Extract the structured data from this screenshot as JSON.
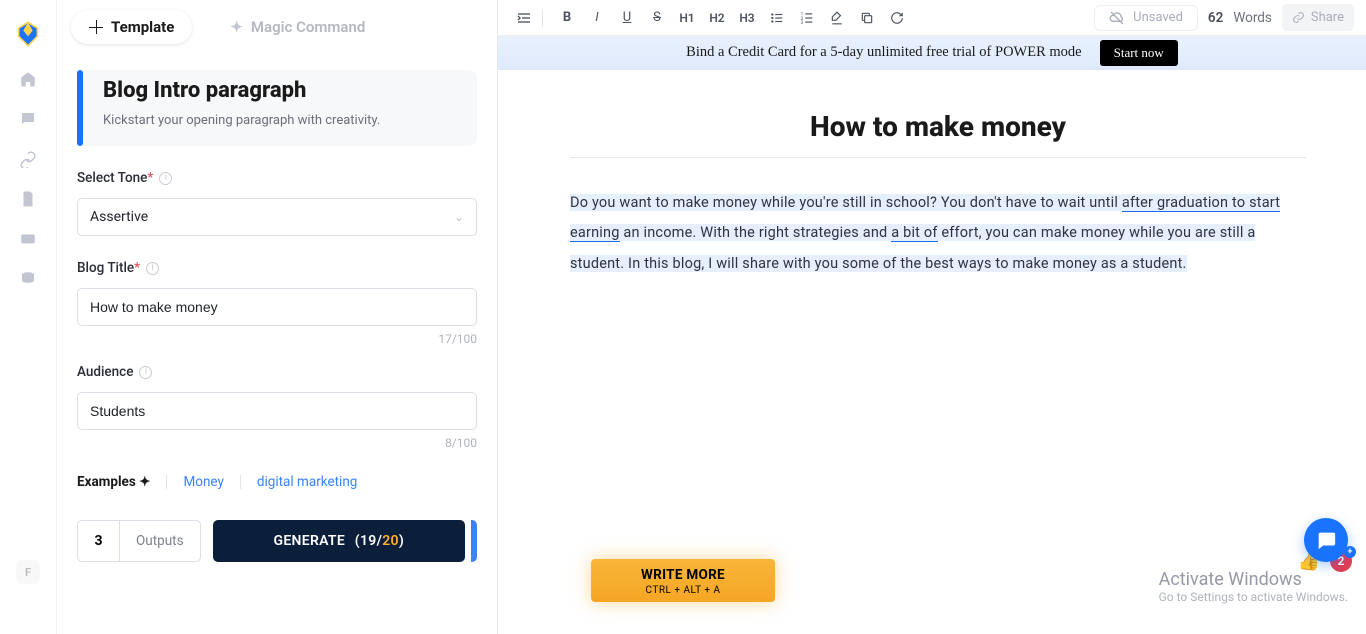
{
  "tabs": {
    "template": "Template",
    "magic": "Magic Command"
  },
  "rail": {
    "badge": "F"
  },
  "card": {
    "title": "Blog Intro paragraph",
    "subtitle": "Kickstart your opening paragraph with creativity."
  },
  "form": {
    "tone_label": "Select Tone",
    "tone_value": "Assertive",
    "title_label": "Blog Title",
    "title_value": "How to make money",
    "title_count": "17/100",
    "audience_label": "Audience",
    "audience_value": "Students",
    "audience_count": "8/100",
    "examples_label": "Examples",
    "examples": [
      "Money",
      "digital marketing"
    ],
    "outputs_num": "3",
    "outputs_label": "Outputs",
    "generate_label": "GENERATE",
    "gen_used": "19",
    "gen_max": "20"
  },
  "toolbar": {
    "h1": "H1",
    "h2": "H2",
    "h3": "H3",
    "unsaved": "Unsaved",
    "word_num": "62",
    "word_label": "Words",
    "share": "Share"
  },
  "promo": {
    "text": "Bind a Credit Card for a 5-day unlimited free trial of POWER mode",
    "cta": "Start now"
  },
  "doc": {
    "title": "How to make money",
    "p1a": "Do you want to make money while you're still in school? You don't have to wait until ",
    "p1b": "after graduation to start earning",
    "p1c": " an income. With the right strategies and ",
    "p1d": "a bit of",
    "p1e": " effort, you can make money while you are still a student. In this blog, I will share with you some of the best ways to make money as a student."
  },
  "write_more": {
    "main": "WRITE MORE",
    "sub": "CTRL + ALT + A"
  },
  "activate": {
    "h": "Activate Windows",
    "s": "Go to Settings to activate Windows."
  },
  "fab": {
    "badge": "2"
  }
}
